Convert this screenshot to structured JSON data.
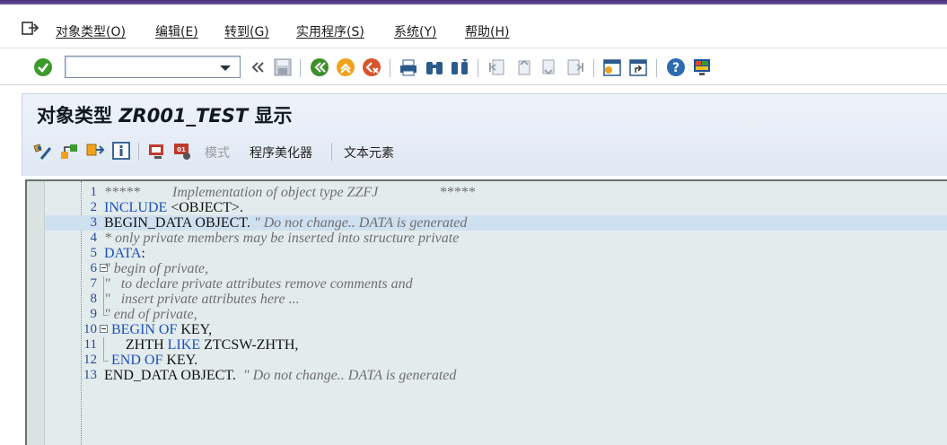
{
  "menu": {
    "items": [
      "对象类型(O)",
      "编辑(E)",
      "转到(G)",
      "实用程序(S)",
      "系统(Y)",
      "帮助(H)"
    ]
  },
  "toolbar": {
    "command_value": "",
    "icons": [
      "enter-check-icon",
      "back-icon",
      "save-icon",
      "green-back-icon",
      "exit-icon",
      "cancel-icon",
      "print-icon",
      "find-icon",
      "find-next-icon",
      "first-page-icon",
      "prev-page-icon",
      "next-page-icon",
      "last-page-icon",
      "create-session-icon",
      "shortcut-icon",
      "help-icon",
      "layout-icon"
    ]
  },
  "title": {
    "prefix": "对象类型",
    "object": "ZR001_TEST",
    "suffix": "显示"
  },
  "app_toolbar": {
    "mode_label": "模式",
    "pretty_printer_label": "程序美化器",
    "text_elements_label": "文本元素"
  },
  "editor": {
    "current_line": 3,
    "lines": [
      {
        "n": "1",
        "segments": [
          {
            "t": "*****         Implementation of object type ZZFJ                 *****",
            "c": "cm"
          }
        ]
      },
      {
        "n": "2",
        "segments": [
          {
            "t": "INCLUDE",
            "c": "kw"
          },
          {
            "t": " <OBJECT>.",
            "c": "tx"
          }
        ]
      },
      {
        "n": "3",
        "segments": [
          {
            "t": "BEGIN_DATA OBJECT. ",
            "c": "tx"
          },
          {
            "t": "\" Do not change.. DATA is generated",
            "c": "cm"
          }
        ]
      },
      {
        "n": "4",
        "segments": [
          {
            "t": "* only private members may be inserted into structure private",
            "c": "cm"
          }
        ]
      },
      {
        "n": "5",
        "segments": [
          {
            "t": "DATA",
            "c": "kw"
          },
          {
            "t": ":",
            "c": "tx"
          }
        ]
      },
      {
        "n": "6",
        "segments": [
          {
            "t": "\" begin of private,",
            "c": "cm"
          }
        ]
      },
      {
        "n": "7",
        "segments": [
          {
            "t": "\"   to declare private attributes remove comments and",
            "c": "cm"
          }
        ]
      },
      {
        "n": "8",
        "segments": [
          {
            "t": "\"   insert private attributes here ...",
            "c": "cm"
          }
        ]
      },
      {
        "n": "9",
        "segments": [
          {
            "t": "\" end of private,",
            "c": "cm"
          }
        ]
      },
      {
        "n": "10",
        "segments": [
          {
            "t": "  ",
            "c": "tx"
          },
          {
            "t": "BEGIN OF",
            "c": "kw"
          },
          {
            "t": " KEY,",
            "c": "tx"
          }
        ]
      },
      {
        "n": "11",
        "segments": [
          {
            "t": "      ZHTH ",
            "c": "tx"
          },
          {
            "t": "LIKE",
            "c": "kw"
          },
          {
            "t": " ZTCSW-ZHTH,",
            "c": "tx"
          }
        ]
      },
      {
        "n": "12",
        "segments": [
          {
            "t": "  ",
            "c": "tx"
          },
          {
            "t": "END OF",
            "c": "kw"
          },
          {
            "t": " KEY.",
            "c": "tx"
          }
        ]
      },
      {
        "n": "13",
        "segments": [
          {
            "t": "END_DATA OBJECT. ",
            "c": "tx"
          },
          {
            "t": " \" Do not change.. DATA is generated",
            "c": "cm"
          }
        ]
      }
    ]
  },
  "colors": {
    "accent_purple": "#4a2e78",
    "keyword_blue": "#1d4fbf",
    "editor_bg": "#e3ecec"
  }
}
